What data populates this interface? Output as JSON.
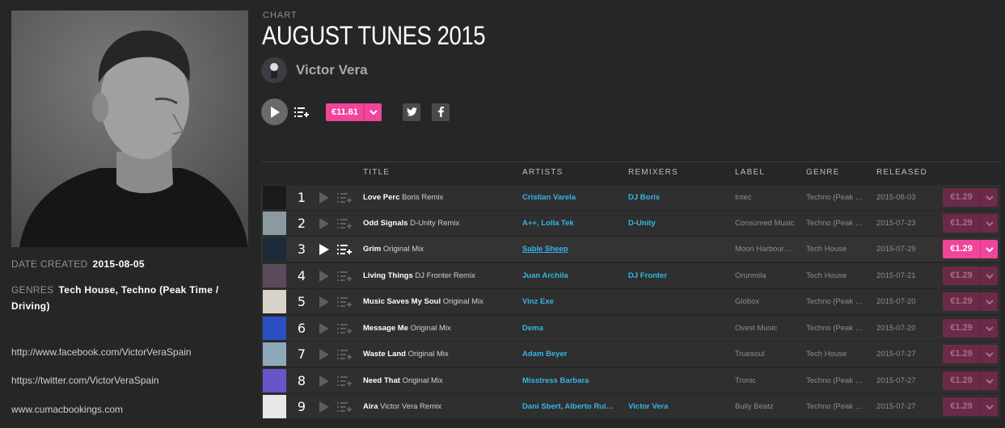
{
  "header": {
    "eyebrow": "CHART",
    "title": "AUGUST TUNES 2015",
    "artist": "Victor Vera",
    "price": "€11.61"
  },
  "meta": {
    "created_label": "DATE CREATED",
    "created_value": "2015-08-05",
    "genres_label": "GENRES",
    "genres_value": "Tech House, Techno (Peak Time / Driving)",
    "links": [
      "http://www.facebook.com/VictorVeraSpain",
      "https://twitter.com/VictorVeraSpain",
      "www.cumacbookings.com"
    ]
  },
  "columns": {
    "title": "TITLE",
    "artists": "ARTISTS",
    "remixers": "REMIXERS",
    "label": "LABEL",
    "genre": "GENRE",
    "released": "RELEASED"
  },
  "colors": {
    "accent": "#f0459a",
    "link": "#35b6e5",
    "background": "#262626"
  },
  "tracks": [
    {
      "num": "1",
      "title": "Love Perc",
      "mix": "Boris Remix",
      "artists": "Cristian Varela",
      "remixers": "DJ Boris",
      "label": "Intec",
      "genre": "Techno (Peak …",
      "released": "2015-08-03",
      "price": "€1.29",
      "thumb": "#1a1a1a"
    },
    {
      "num": "2",
      "title": "Odd Signals",
      "mix": "D-Unity Remix",
      "artists": "A++, Lolla Tek",
      "remixers": "D-Unity",
      "label": "Consumed Music",
      "genre": "Techno (Peak …",
      "released": "2015-07-23",
      "price": "€1.29",
      "thumb": "#8a9aa0"
    },
    {
      "num": "3",
      "title": "Grim",
      "mix": "Original Mix",
      "artists": "Sable Sheep",
      "remixers": "",
      "label": "Moon Harbour…",
      "genre": "Tech House",
      "released": "2015-07-29",
      "price": "€1.29",
      "thumb": "#1d2a3a"
    },
    {
      "num": "4",
      "title": "Living Things",
      "mix": "DJ Fronter Remix",
      "artists": "Juan Archila",
      "remixers": "DJ Fronter",
      "label": "Orunmila",
      "genre": "Tech House",
      "released": "2015-07-21",
      "price": "€1.29",
      "thumb": "#5a4a5a"
    },
    {
      "num": "5",
      "title": "Music Saves My Soul",
      "mix": "Original Mix",
      "artists": "Vinz Exe",
      "remixers": "",
      "label": "Globox",
      "genre": "Techno (Peak …",
      "released": "2015-07-20",
      "price": "€1.29",
      "thumb": "#d8d2c8"
    },
    {
      "num": "6",
      "title": "Message Me",
      "mix": "Original Mix",
      "artists": "Dema",
      "remixers": "",
      "label": "Ovest Music",
      "genre": "Techno (Peak …",
      "released": "2015-07-20",
      "price": "€1.29",
      "thumb": "#2a4fc0"
    },
    {
      "num": "7",
      "title": "Waste Land",
      "mix": "Original Mix",
      "artists": "Adam Beyer",
      "remixers": "",
      "label": "Truesoul",
      "genre": "Tech House",
      "released": "2015-07-27",
      "price": "€1.29",
      "thumb": "#8fa8b8"
    },
    {
      "num": "8",
      "title": "Need That",
      "mix": "Original Mix",
      "artists": "Misstress Barbara",
      "remixers": "",
      "label": "Tronic",
      "genre": "Techno (Peak …",
      "released": "2015-07-27",
      "price": "€1.29",
      "thumb": "#6a55c8"
    },
    {
      "num": "9",
      "title": "Aira",
      "mix": "Victor Vera Remix",
      "artists": "Dani Sbert, Alberto Rui…",
      "remixers": "Victor Vera",
      "label": "Bully Beatz",
      "genre": "Techno (Peak …",
      "released": "2015-07-27",
      "price": "€1.29",
      "thumb": "#e8e8e8"
    }
  ]
}
